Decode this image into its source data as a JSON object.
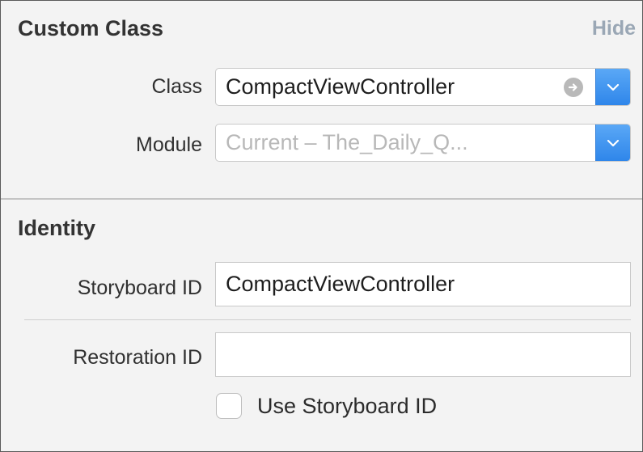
{
  "custom_class": {
    "title": "Custom Class",
    "hide_label": "Hide",
    "class_label": "Class",
    "class_value": "CompactViewController",
    "module_label": "Module",
    "module_placeholder": "Current – The_Daily_Q..."
  },
  "identity": {
    "title": "Identity",
    "storyboard_id_label": "Storyboard ID",
    "storyboard_id_value": "CompactViewController",
    "restoration_id_label": "Restoration ID",
    "restoration_id_value": "",
    "use_storyboard_id_label": "Use Storyboard ID",
    "use_storyboard_id_checked": false
  },
  "colors": {
    "accent": "#3b8ff0",
    "hide_link": "#9aa7b5",
    "panel_background": "#f3f3f3"
  }
}
